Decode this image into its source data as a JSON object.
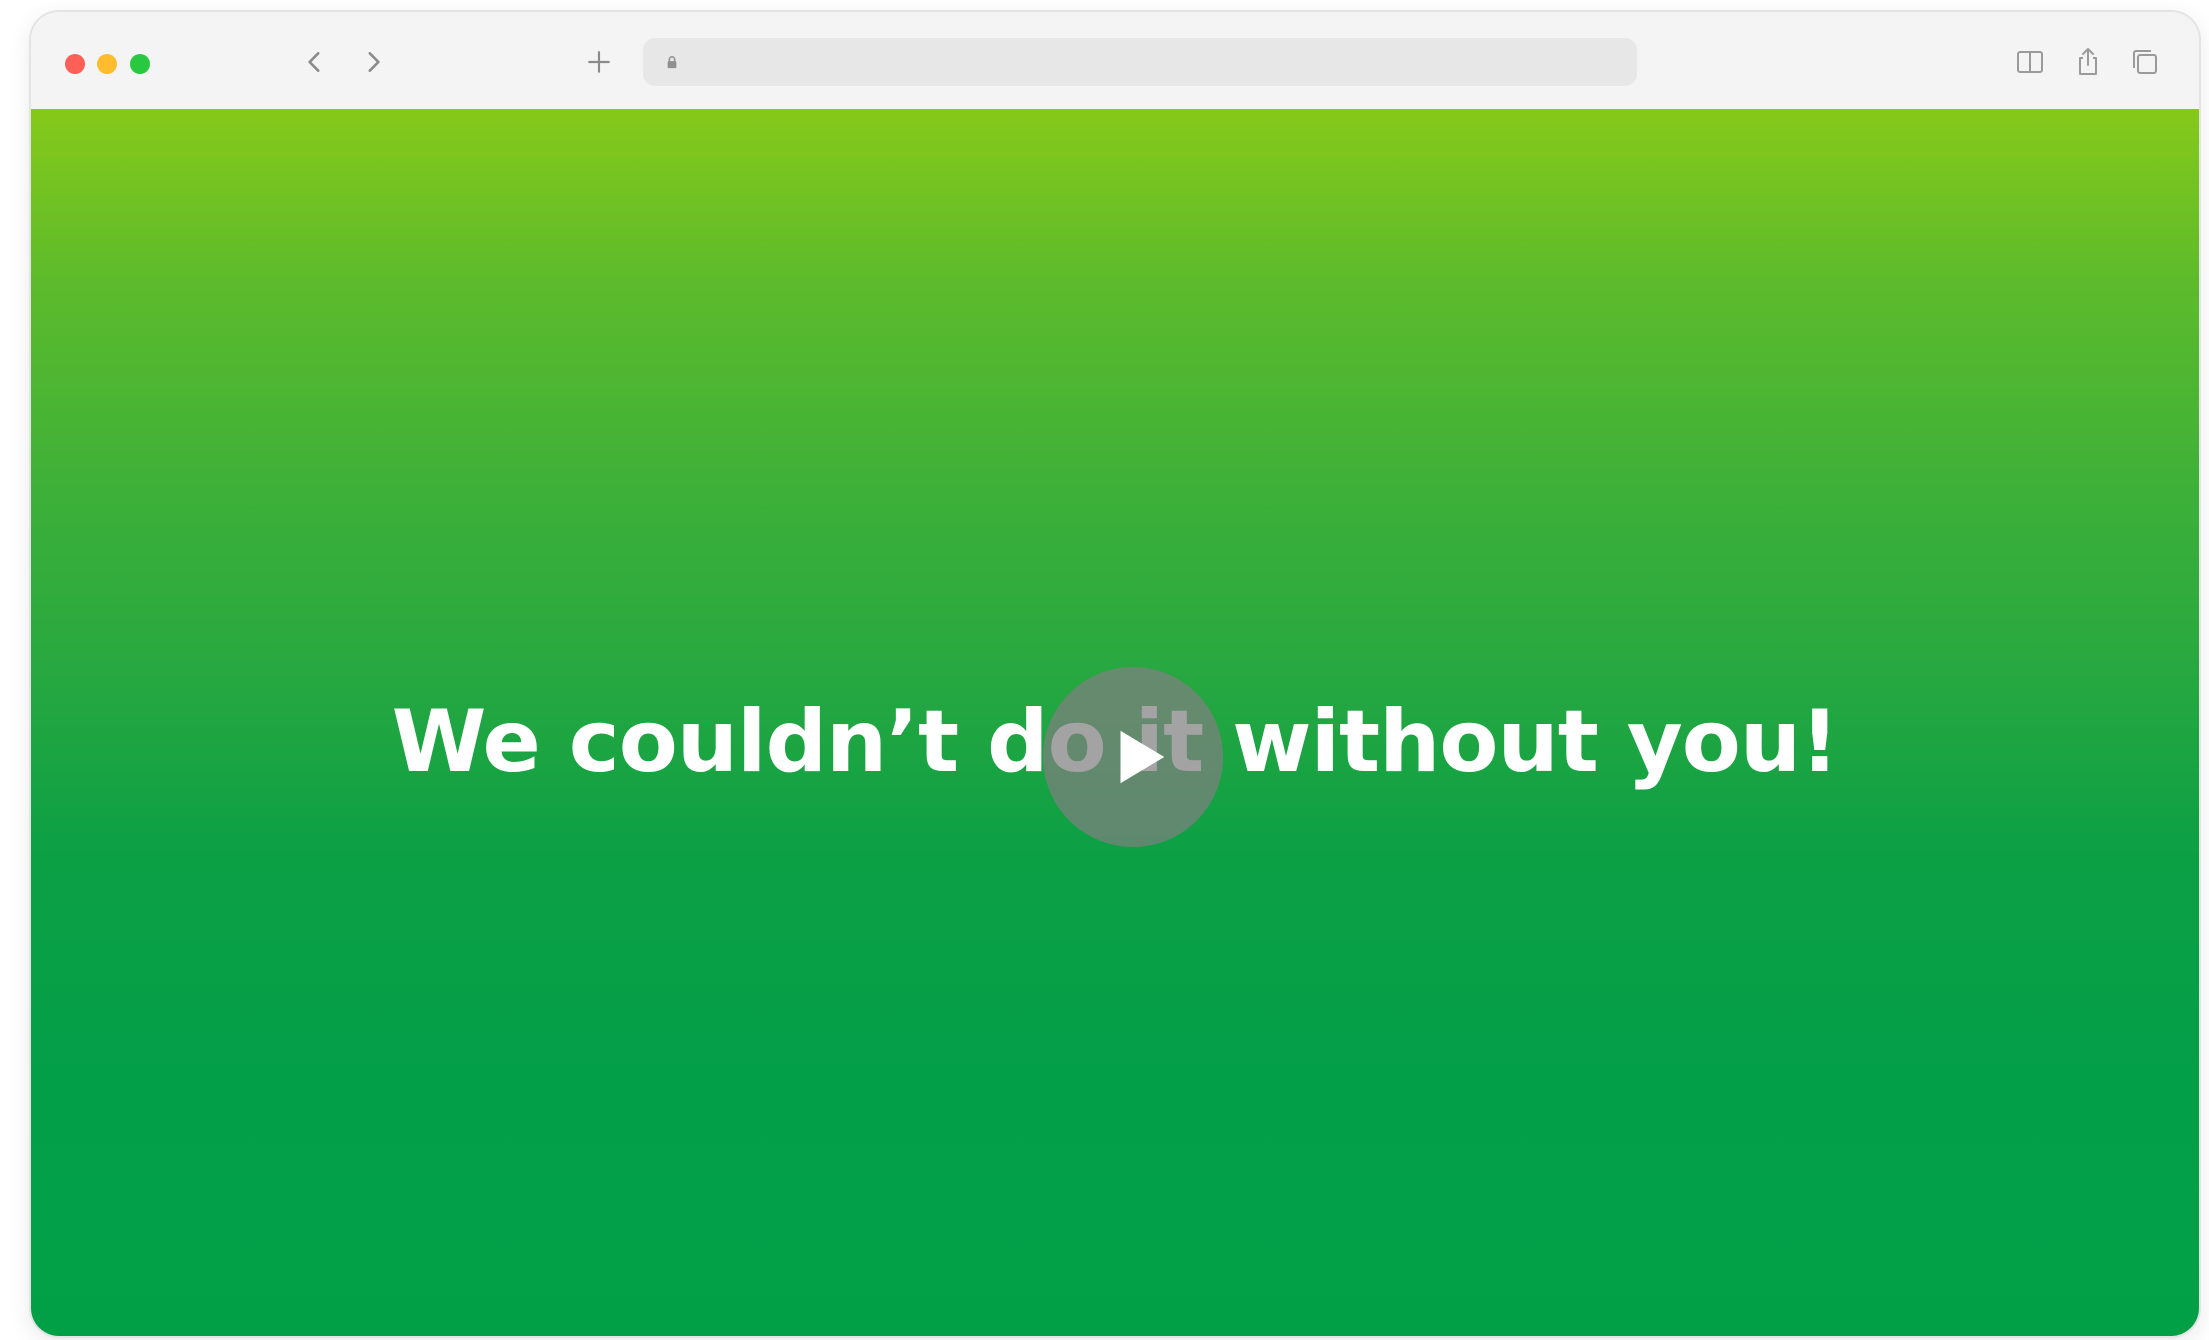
{
  "browser": {
    "window_controls": {
      "close_color": "#fe5f57",
      "minimize_color": "#febc2e",
      "maximize_color": "#28c840"
    },
    "toolbar": {
      "back_icon": "chevron-left-icon",
      "forward_icon": "chevron-right-icon",
      "new_tab_icon": "plus-icon",
      "address_bar": {
        "lock_icon": "lock-icon",
        "url": ""
      },
      "reader_icon": "reader-view-icon",
      "share_icon": "share-icon",
      "tabs_icon": "tab-overview-icon"
    }
  },
  "page": {
    "headline": "We couldn’t do it without you!",
    "play_icon": "play-icon",
    "colors": {
      "gradient_top": "#86c91a",
      "gradient_bottom": "#01a047",
      "headline_color": "#ffffff"
    }
  }
}
